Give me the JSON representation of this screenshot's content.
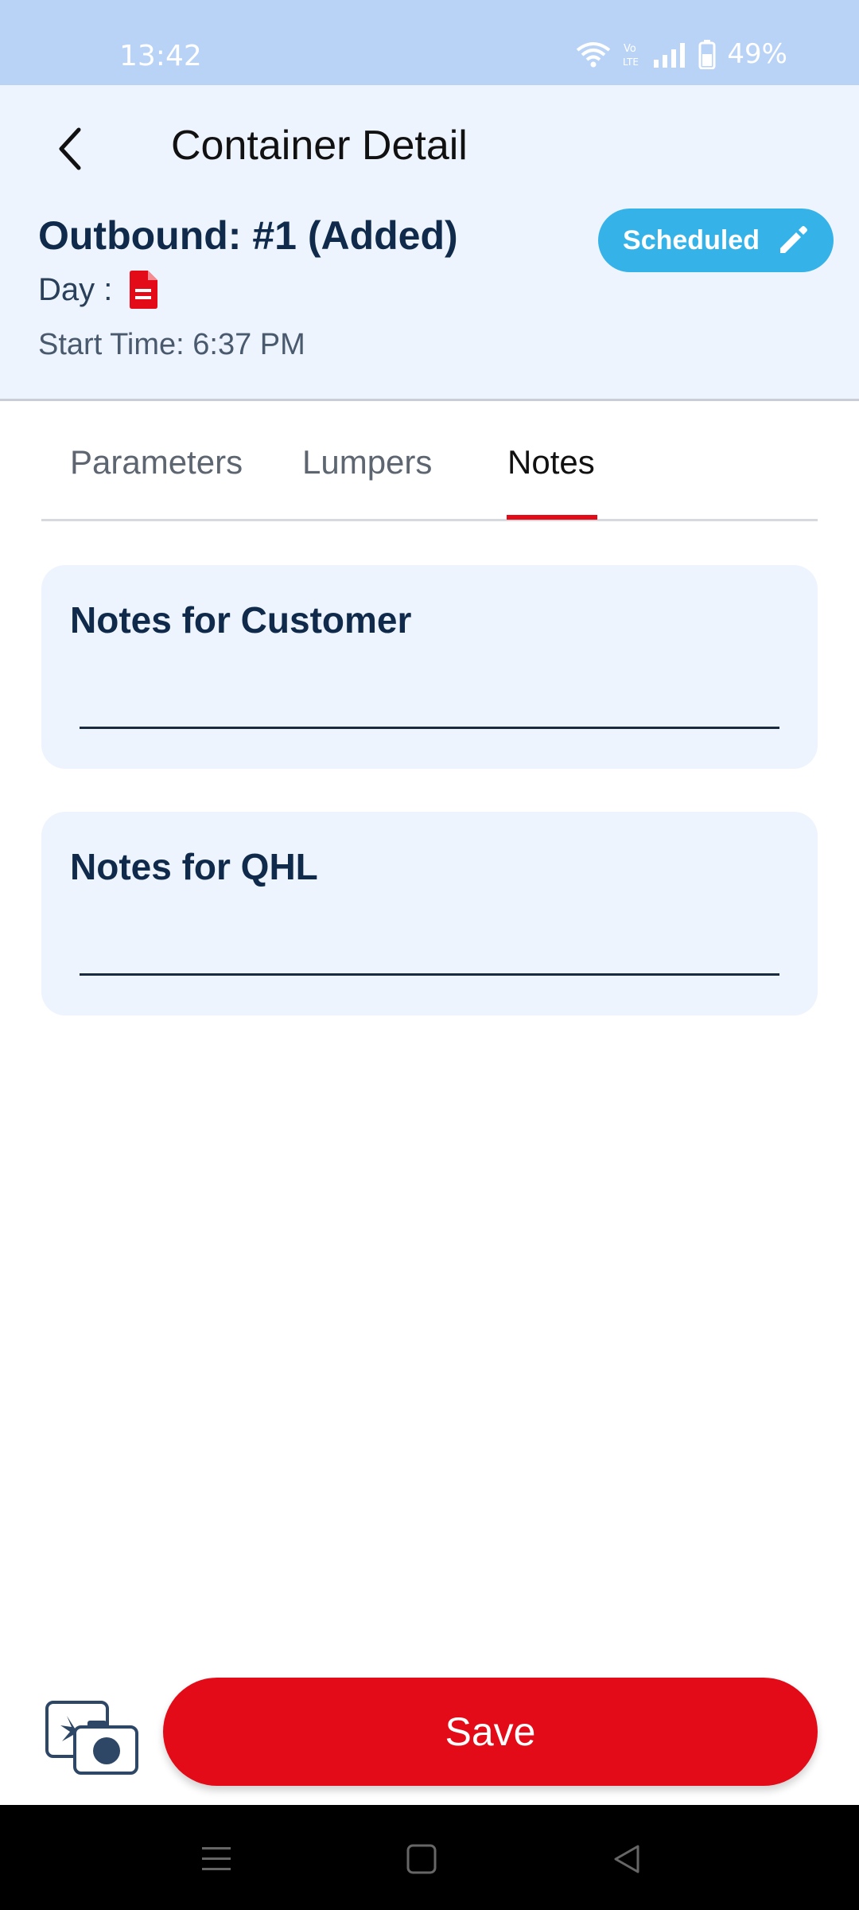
{
  "status_bar": {
    "time": "13:42",
    "battery": "49%",
    "icons": [
      "wifi-icon",
      "volte-icon",
      "signal-icon",
      "battery-icon"
    ]
  },
  "header": {
    "title": "Container Detail",
    "outbound_title": "Outbound: #1 (Added)",
    "day_label": "Day :",
    "start_time": "Start Time: 6:37 PM",
    "status_button": "Scheduled"
  },
  "tabs": [
    {
      "label": "Parameters",
      "active": false
    },
    {
      "label": "Lumpers",
      "active": false
    },
    {
      "label": "Notes",
      "active": true
    }
  ],
  "notes": {
    "customer": {
      "label": "Notes for Customer",
      "value": ""
    },
    "qhl": {
      "label": "Notes for QHL",
      "value": ""
    }
  },
  "actions": {
    "save_label": "Save"
  },
  "colors": {
    "accent_red": "#e30b17",
    "scheduled_blue": "#35b3e8",
    "header_bg": "#eef4fd",
    "status_bar_bg": "#b9d3f7",
    "navy_text": "#0f2a4a"
  }
}
